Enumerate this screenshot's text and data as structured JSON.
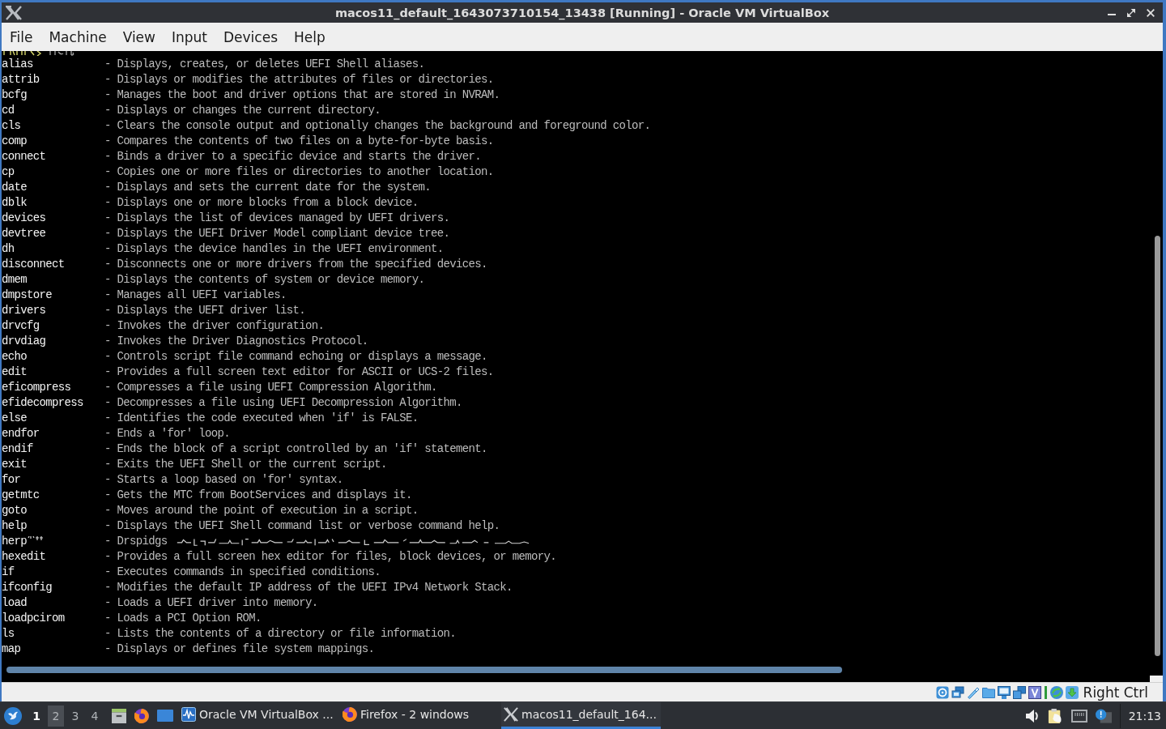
{
  "window": {
    "title": "macos11_default_1643073710154_13438 [Running] - Oracle VM VirtualBox"
  },
  "menu": [
    "File",
    "Machine",
    "View",
    "Input",
    "Devices",
    "Help"
  ],
  "console": {
    "lines": [
      {
        "kind": "entry",
        "command": "alias",
        "description": "- Displays, creates, or deletes UEFI Shell aliases."
      },
      {
        "kind": "entry",
        "command": "attrib",
        "description": "- Displays or modifies the attributes of files or directories."
      },
      {
        "kind": "entry",
        "command": "bcfg",
        "description": "- Manages the boot and driver options that are stored in NVRAM."
      },
      {
        "kind": "entry",
        "command": "cd",
        "description": "- Displays or changes the current directory."
      },
      {
        "kind": "entry",
        "command": "cls",
        "description": "- Clears the console output and optionally changes the background and foreground color."
      },
      {
        "kind": "entry",
        "command": "comp",
        "description": "- Compares the contents of two files on a byte-for-byte basis."
      },
      {
        "kind": "entry",
        "command": "connect",
        "description": "- Binds a driver to a specific device and starts the driver."
      },
      {
        "kind": "entry",
        "command": "cp",
        "description": "- Copies one or more files or directories to another location."
      },
      {
        "kind": "entry",
        "command": "date",
        "description": "- Displays and sets the current date for the system."
      },
      {
        "kind": "entry",
        "command": "dblk",
        "description": "- Displays one or more blocks from a block device."
      },
      {
        "kind": "entry",
        "command": "devices",
        "description": "- Displays the list of devices managed by UEFI drivers."
      },
      {
        "kind": "entry",
        "command": "devtree",
        "description": "- Displays the UEFI Driver Model compliant device tree."
      },
      {
        "kind": "entry",
        "command": "dh",
        "description": "- Displays the device handles in the UEFI environment."
      },
      {
        "kind": "entry",
        "command": "disconnect",
        "description": "- Disconnects one or more drivers from the specified devices."
      },
      {
        "kind": "entry",
        "command": "dmem",
        "description": "- Displays the contents of system or device memory."
      },
      {
        "kind": "entry",
        "command": "dmpstore",
        "description": "- Manages all UEFI variables."
      },
      {
        "kind": "entry",
        "command": "drivers",
        "description": "- Displays the UEFI driver list."
      },
      {
        "kind": "entry",
        "command": "drvcfg",
        "description": "- Invokes the driver configuration."
      },
      {
        "kind": "entry",
        "command": "drvdiag",
        "description": "- Invokes the Driver Diagnostics Protocol."
      },
      {
        "kind": "entry",
        "command": "echo",
        "description": "- Controls script file command echoing or displays a message."
      },
      {
        "kind": "entry",
        "command": "edit",
        "description": "- Provides a full screen text editor for ASCII or UCS-2 files."
      },
      {
        "kind": "entry",
        "command": "eficompress",
        "description": "- Compresses a file using UEFI Compression Algorithm."
      },
      {
        "kind": "entry",
        "command": "efidecompress",
        "description": "- Decompresses a file using UEFI Decompression Algorithm."
      },
      {
        "kind": "entry",
        "command": "else",
        "description": "- Identifies the code executed when 'if' is FALSE."
      },
      {
        "kind": "entry",
        "command": "endfor",
        "description": "- Ends a 'for' loop."
      },
      {
        "kind": "entry",
        "command": "endif",
        "description": "- Ends the block of a script controlled by an 'if' statement."
      },
      {
        "kind": "entry",
        "command": "exit",
        "description": "- Exits the UEFI Shell or the current script."
      },
      {
        "kind": "entry",
        "command": "for",
        "description": "- Starts a loop based on 'for' syntax."
      },
      {
        "kind": "entry",
        "command": "getmtc",
        "description": "- Gets the MTC from BootServices and displays it."
      },
      {
        "kind": "entry",
        "command": "goto",
        "description": "- Moves around the point of execution in a script."
      },
      {
        "kind": "entry",
        "command": "help",
        "description": "- Displays the UEFI Shell command list or verbose command help."
      },
      {
        "kind": "garbled",
        "command": "herp",
        "description": "- Drspidgs"
      },
      {
        "kind": "entry",
        "command": "hexedit",
        "description": "- Provides a full screen hex editor for files, block devices, or memory."
      },
      {
        "kind": "entry",
        "command": "if",
        "description": "- Executes commands in specified conditions."
      },
      {
        "kind": "entry",
        "command": "ifconfig",
        "description": "- Modifies the default IP address of the UEFI IPv4 Network Stack."
      },
      {
        "kind": "entry",
        "command": "load",
        "description": "- Loads a UEFI driver into memory."
      },
      {
        "kind": "entry",
        "command": "loadpcirom",
        "description": "- Loads a PCI Option ROM."
      },
      {
        "kind": "entry",
        "command": "ls",
        "description": "- Lists the contents of a directory or file information."
      },
      {
        "kind": "entry",
        "command": "map",
        "description": "- Displays or defines file system mappings."
      }
    ]
  },
  "status_bar": {
    "host_key": "Right Ctrl"
  },
  "taskbar": {
    "workspaces": [
      {
        "label": "1",
        "current": true,
        "selected": false
      },
      {
        "label": "2",
        "current": false,
        "selected": true
      },
      {
        "label": "3",
        "current": false,
        "selected": false
      },
      {
        "label": "4",
        "current": false,
        "selected": false
      }
    ],
    "tasks": [
      {
        "kind": "virtualbox",
        "label": "Oracle VM VirtualBox ...",
        "selected": false
      },
      {
        "kind": "firefox",
        "label": "Firefox - 2 windows",
        "selected": false
      },
      {
        "kind": "xwindow",
        "label": "macos11_default_164...",
        "selected": true
      }
    ],
    "clock": "21:13"
  }
}
